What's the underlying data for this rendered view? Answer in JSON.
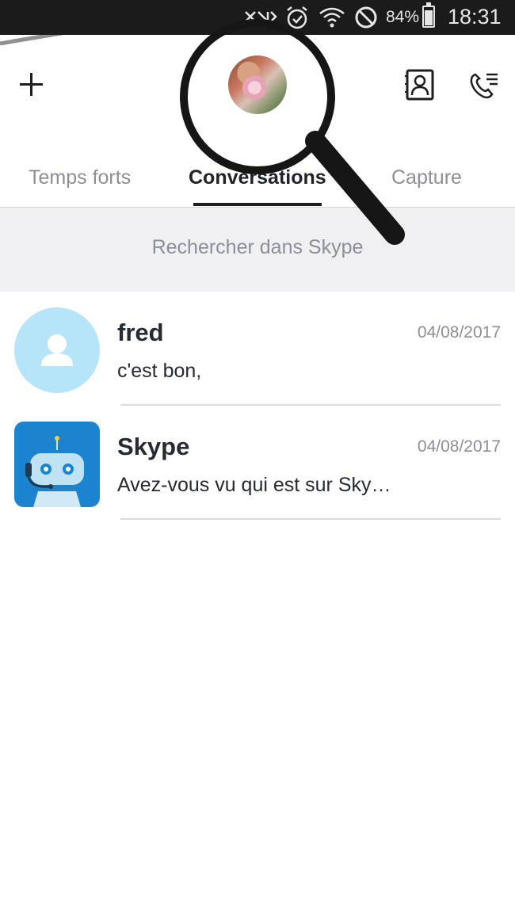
{
  "status_bar": {
    "battery_percent": "84%",
    "time": "18:31",
    "icons": [
      "nfc-icon",
      "alarm-icon",
      "wifi-icon",
      "do-not-disturb-icon",
      "battery-icon"
    ]
  },
  "header": {
    "add_icon": "plus-icon",
    "profile_avatar": "profile-photo",
    "contacts_icon": "contacts-icon",
    "calls_icon": "calls-icon"
  },
  "tabs": [
    {
      "label": "Temps forts",
      "active": false
    },
    {
      "label": "Conversations",
      "active": true
    },
    {
      "label": "Capture",
      "active": false
    }
  ],
  "search": {
    "placeholder": "Rechercher dans Skype"
  },
  "conversations": [
    {
      "name": "fred",
      "date": "04/08/2017",
      "last_message": "c'est bon,",
      "avatar": "default-user-icon"
    },
    {
      "name": "Skype",
      "date": "04/08/2017",
      "last_message": "Avez-vous vu qui est sur Sky…",
      "avatar": "skype-bot-icon"
    }
  ],
  "colors": {
    "status_bar": "#1b1b1b",
    "text_primary": "#262a33",
    "text_muted": "#8b8f96",
    "search_bg": "#f0f0f2",
    "fred_avatar_bg": "#b6e4f8",
    "skype_avatar_bg": "#1c83cf"
  }
}
